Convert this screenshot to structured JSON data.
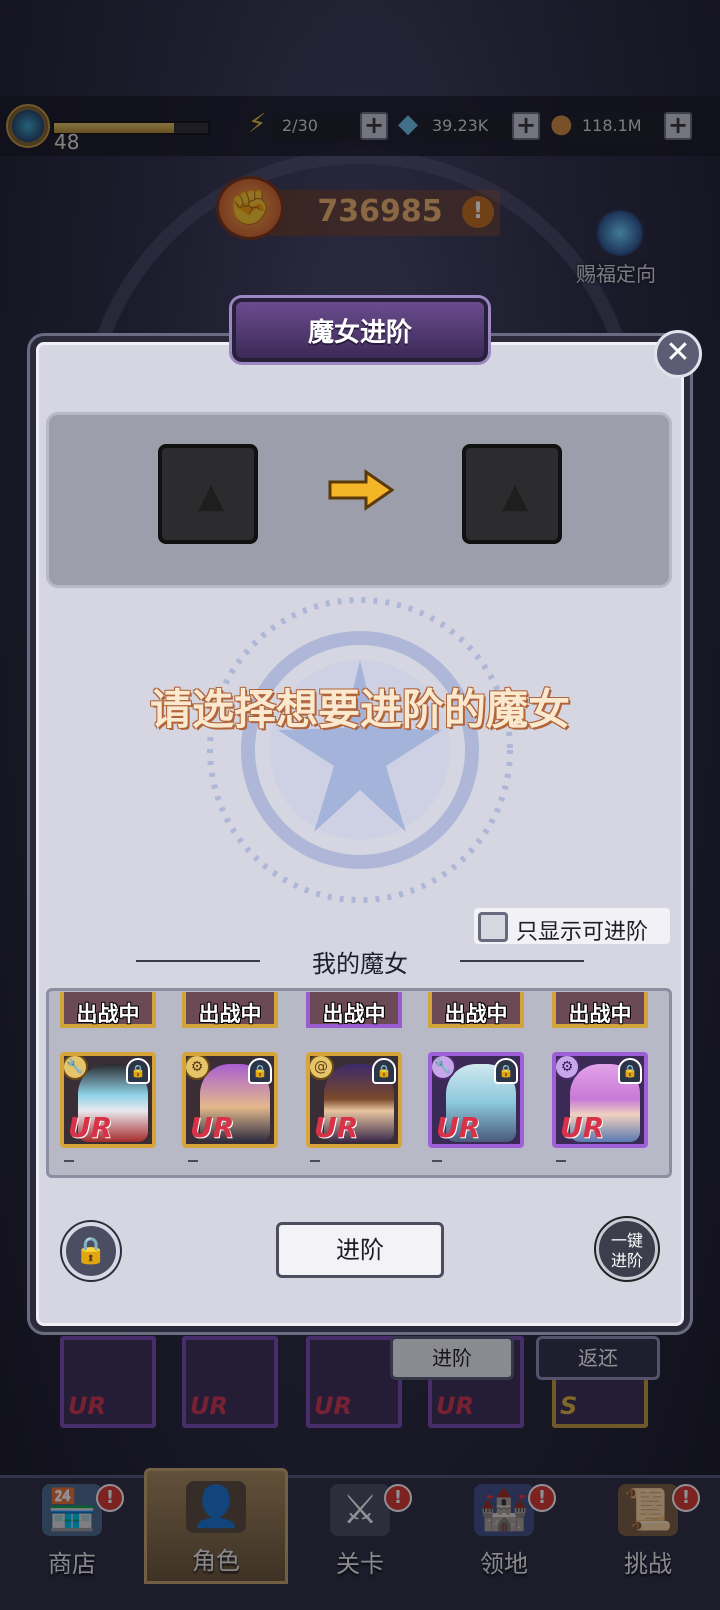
{
  "header": {
    "level": "48",
    "xp_progress": 0.78,
    "energy": "2/30",
    "gems": "39.23K",
    "coins": "118.1M",
    "plus": "+"
  },
  "power": {
    "value": "736985",
    "info": "!"
  },
  "blessing": {
    "label": "赐福定向"
  },
  "modal": {
    "title": "魔女进阶",
    "close": "✕",
    "prompt": "请选择想要进阶的魔女",
    "filter_label": "只显示可进阶",
    "section_title": "我的魔女",
    "evolve_button": "进阶",
    "one_click_button_line1": "一键",
    "one_click_button_line2": "进阶",
    "deployed_label": "出战中"
  },
  "roster": {
    "deployed": [
      "出战中",
      "出战中",
      "出战中",
      "出战中",
      "出战中"
    ],
    "cards": [
      {
        "rarity": "UR",
        "frame": "gold"
      },
      {
        "rarity": "UR",
        "frame": "gold"
      },
      {
        "rarity": "UR",
        "frame": "gold"
      },
      {
        "rarity": "UR",
        "frame": "purple"
      },
      {
        "rarity": "UR",
        "frame": "purple"
      }
    ],
    "dashes": [
      "-",
      "-",
      "-",
      "-",
      "-"
    ]
  },
  "underlying": {
    "evolve_tab": "进阶",
    "return_tab": "返还",
    "card_rarities": [
      "UR",
      "UR",
      "UR",
      "UR",
      "S"
    ]
  },
  "nav": {
    "items": [
      {
        "label": "商店",
        "badge": "!"
      },
      {
        "label": "角色",
        "badge": ""
      },
      {
        "label": "关卡",
        "badge": "!"
      },
      {
        "label": "领地",
        "badge": "!"
      },
      {
        "label": "挑战",
        "badge": "!"
      }
    ]
  },
  "colors": {
    "modal_bg": "#d6d6e2",
    "gold_frame": "#d6a43a",
    "purple_frame": "#9f5fd9",
    "ur_red": "#d83248",
    "power_orange": "#f2b46a"
  }
}
